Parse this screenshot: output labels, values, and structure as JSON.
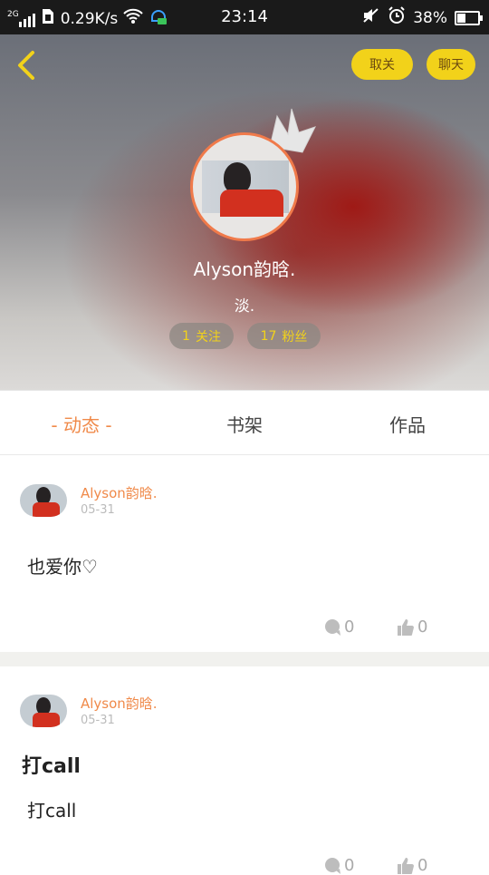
{
  "status_bar": {
    "network": "2G",
    "speed": "0.29K/s",
    "time": "23:14",
    "battery": "38%",
    "battery_level": 0.38
  },
  "header": {
    "unfollow_label": "取关",
    "chat_label": "聊天",
    "username": "Alyson韵晗.",
    "bio": "淡.",
    "follow_count": "1",
    "follow_label": "关注",
    "fans_count": "17",
    "fans_label": "粉丝"
  },
  "tabs": [
    {
      "label": "- 动态 -"
    },
    {
      "label": "书架"
    },
    {
      "label": "作品"
    }
  ],
  "posts": [
    {
      "author": "Alyson韵晗.",
      "date": "05-31",
      "title": "",
      "text": "也爱你♡",
      "comments": "0",
      "likes": "0"
    },
    {
      "author": "Alyson韵晗.",
      "date": "05-31",
      "title": "打call",
      "text": "打call",
      "comments": "0",
      "likes": "0"
    }
  ],
  "colors": {
    "accent": "#f08a4a",
    "pill": "#f2d21a",
    "status_bg": "#1a1a1a"
  }
}
